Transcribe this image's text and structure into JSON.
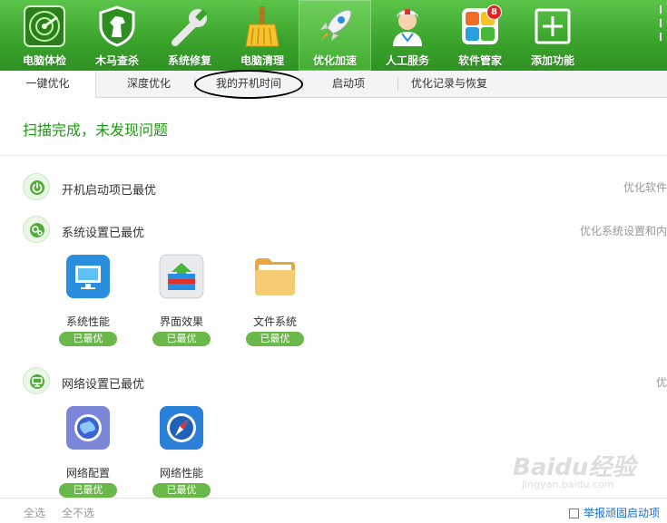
{
  "toolbar": {
    "items": [
      {
        "label": "电脑体检",
        "icon": "radar-icon"
      },
      {
        "label": "木马查杀",
        "icon": "horse-shield-icon"
      },
      {
        "label": "系统修复",
        "icon": "wrench-icon"
      },
      {
        "label": "电脑清理",
        "icon": "broom-icon"
      },
      {
        "label": "优化加速",
        "icon": "rocket-icon"
      },
      {
        "label": "人工服务",
        "icon": "doctor-icon"
      },
      {
        "label": "软件管家",
        "icon": "app-grid-icon",
        "badge": "8"
      },
      {
        "label": "添加功能",
        "icon": "plus-icon"
      }
    ],
    "active_index": 4,
    "accent": "#3aa22b"
  },
  "tabs": {
    "items": [
      "一键优化",
      "深度优化",
      "我的开机时间",
      "启动项",
      "优化记录与恢复"
    ],
    "active_index": 0
  },
  "main": {
    "status": "扫描完成，未发现问题",
    "status_color": "#1e9a12",
    "sections": [
      {
        "title": "开机启动项已最优",
        "right_text": "优化软件",
        "icon": "power-icon",
        "items": []
      },
      {
        "title": "系统设置已最优",
        "right_text": "优化系统设置和内",
        "icon": "gears-icon",
        "items": [
          {
            "name": "系统性能",
            "status": "已最优",
            "icon": "monitor-icon"
          },
          {
            "name": "界面效果",
            "status": "已最优",
            "icon": "interface-icon"
          },
          {
            "name": "文件系统",
            "status": "已最优",
            "icon": "folder-icon"
          }
        ]
      },
      {
        "title": "网络设置已最优",
        "right_text": "优",
        "icon": "network-icon",
        "items": [
          {
            "name": "网络配置",
            "status": "已最优",
            "icon": "globe-icon"
          },
          {
            "name": "网络性能",
            "status": "已最优",
            "icon": "compass-icon"
          }
        ]
      }
    ]
  },
  "bottom": {
    "select_all": "全选",
    "select_none": "全不选",
    "report": "举报顽固启动项"
  },
  "watermark": {
    "brand": "Baidu经验",
    "url": "jingyan.baidu.com"
  }
}
